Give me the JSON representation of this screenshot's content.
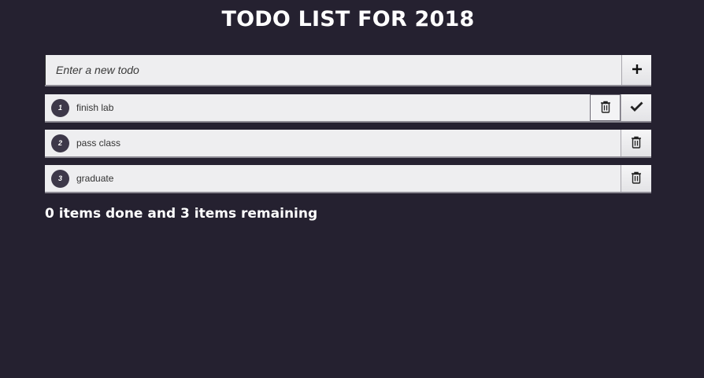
{
  "header": {
    "title": "TODO LIST FOR 2018"
  },
  "new_todo": {
    "placeholder": "Enter a new todo",
    "add_icon": "plus-icon"
  },
  "todos": [
    {
      "number": "1",
      "text": "finish lab",
      "delete_icon": "trash-icon",
      "complete_icon": "checkmark-icon"
    },
    {
      "number": "2",
      "text": "pass class",
      "delete_icon": "trash-icon"
    },
    {
      "number": "3",
      "text": "graduate",
      "delete_icon": "trash-icon"
    }
  ],
  "footer": {
    "status_text": "0 items done and 3 items remaining"
  },
  "colors": {
    "background": "#252130",
    "item_background": "#eeeef0",
    "badge": "#3d3849",
    "text_light": "#ffffff"
  }
}
